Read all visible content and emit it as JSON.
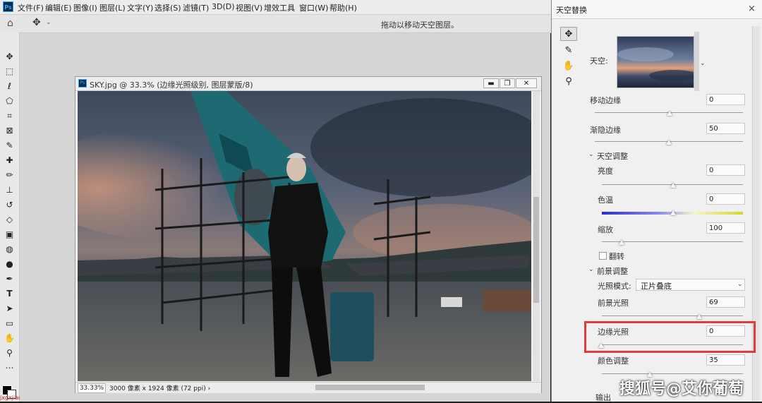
{
  "app": {
    "logo": "Ps",
    "menus": [
      "文件(F)",
      "编辑(E)",
      "图像(I)",
      "图层(L)",
      "文字(Y)",
      "选择(S)",
      "滤镜(T)",
      "3D(D)",
      "视图(V)",
      "增效工具",
      "窗口(W)",
      "帮助(H)"
    ],
    "options_hint": "拖动以移动天空图层。"
  },
  "toolbar": {
    "icons": [
      "move-icon",
      "marquee-icon",
      "lasso-icon",
      "quick-select-icon",
      "crop-icon",
      "frame-icon",
      "eyedropper-icon",
      "spot-heal-icon",
      "brush-icon",
      "stamp-icon",
      "history-brush-icon",
      "eraser-icon",
      "gradient-icon",
      "blur-icon",
      "dodge-icon",
      "pen-icon",
      "type-icon",
      "path-select-icon",
      "rectangle-icon",
      "hand-icon",
      "zoom-icon",
      "more-icon"
    ],
    "watermark": "jxgxjiao.com"
  },
  "document": {
    "icon": "Ps",
    "title": "SKY.jpg @ 33.3% (边缘光照级别, 图层蒙版/8)",
    "zoom": "33.33%",
    "info": "3000 像素 x 1924 像素 (72 ppi)",
    "info_arrow": "›",
    "buttons": {
      "minimize": "▬",
      "restore": "❐",
      "close": "✕"
    }
  },
  "dialog": {
    "title": "天空替换",
    "close": "×",
    "sky_label": "天空:",
    "shift_edge": {
      "label": "移动边缘",
      "value": "0",
      "position": 0.5
    },
    "fade_edge": {
      "label": "渐隐边缘",
      "value": "50",
      "position": 0.5
    },
    "sky_adjust": {
      "label": "天空调整"
    },
    "brightness": {
      "label": "亮度",
      "value": "0",
      "position": 0.5
    },
    "temperature": {
      "label": "色温",
      "value": "0",
      "position": 0.5
    },
    "scale": {
      "label": "缩放",
      "value": "100",
      "position": 0.18
    },
    "flip": {
      "label": "翻转",
      "checked": false
    },
    "fg_adjust": {
      "label": "前景调整"
    },
    "lighting_mode": {
      "label": "光照模式:",
      "value": "正片叠底"
    },
    "fg_lighting": {
      "label": "前景光照",
      "value": "69",
      "position": 0.69
    },
    "edge_lighting": {
      "label": "边缘光照",
      "value": "0",
      "position": 0.0
    },
    "color_adjust": {
      "label": "颜色调整",
      "value": "35",
      "position": 0.35
    },
    "output_label": "输出"
  },
  "watermark_right": "搜狐号@艾你葡萄",
  "colors": {
    "highlight": "#e43a3a",
    "ps_blue": "#31a8ff"
  }
}
